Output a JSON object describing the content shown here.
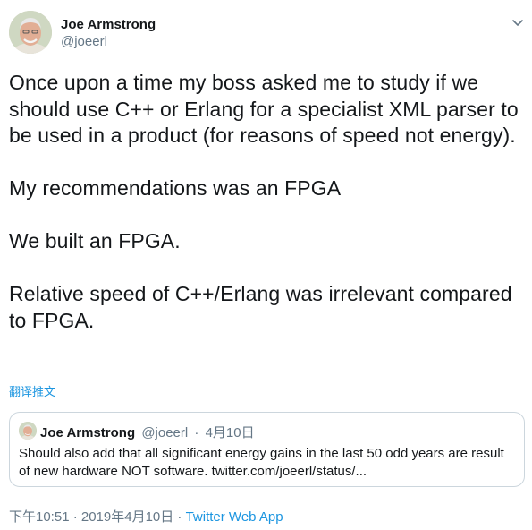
{
  "author": {
    "name": "Joe Armstrong",
    "handle": "@joeerl",
    "avatar_icon": "user-avatar"
  },
  "menu_icon": "chevron-down-icon",
  "tweet": {
    "paragraphs": [
      "Once upon a time my boss asked me to study if we should use C++ or Erlang for a specialist XML parser to be used in a product (for reasons of speed not energy).",
      "My recommendations was an FPGA",
      "We built an FPGA.",
      "Relative speed of C++/Erlang was irrelevant compared to FPGA."
    ],
    "translate_label": "翻译推文"
  },
  "quote": {
    "name": "Joe Armstrong",
    "handle": "@joeerl",
    "separator": "·",
    "date": "4月10日",
    "text": "Should also add that all significant energy gains in the last 50 odd years are result of new hardware NOT software. twitter.com/joeerl/status/..."
  },
  "meta": {
    "timestamp": "下午10:51 · 2019年4月10日 · ",
    "app": "Twitter Web App"
  },
  "colors": {
    "link": "#1b95e0",
    "secondary_text": "#657786",
    "border": "#ccd6dd"
  }
}
